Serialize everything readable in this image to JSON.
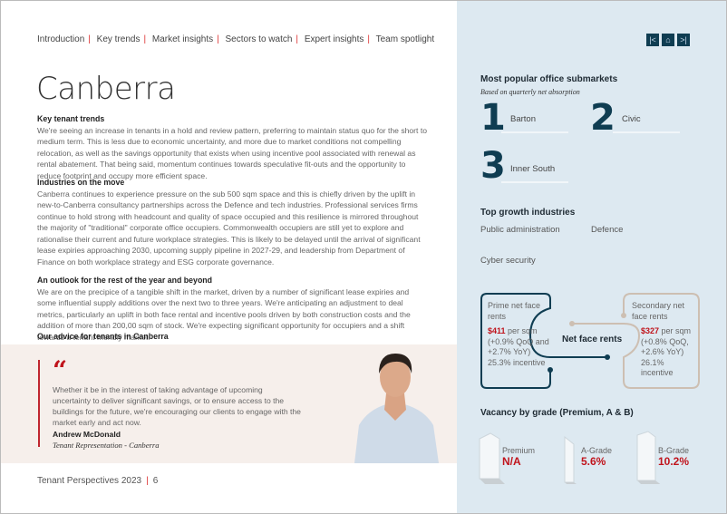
{
  "nav": {
    "items": [
      "Introduction",
      "Key trends",
      "Market insights",
      "Sectors to watch",
      "Expert insights",
      "Team spotlight"
    ]
  },
  "title": "Canberra",
  "sections": [
    {
      "heading": "Key tenant trends",
      "body": "We're seeing an increase in tenants in a hold and review pattern, preferring to maintain status quo for the short to medium term. This is less due to economic uncertainty, and more due to market conditions not compelling relocation, as well as the savings opportunity that exists when using incentive pool associated with renewal as rental abatement. That being said, momentum continues towards speculative fit-outs and the opportunity to reduce footprint and occupy more efficient space."
    },
    {
      "heading": "Industries on the move",
      "body": "Canberra continues to experience pressure on the sub 500 sqm space and this is chiefly driven by the uplift in new-to-Canberra consultancy partnerships across the Defence and tech industries. Professional services firms continue to hold strong with headcount and quality of space occupied and this resilience is mirrored throughout the majority of \"traditional\" corporate office occupiers. Commonwealth occupiers are still yet to explore and rationalise their current and future workplace strategies. This is likely to be delayed until the arrival of significant lease expiries approaching 2030, upcoming supply pipeline in 2027-29, and leadership from Department of Finance on both workplace strategy and ESG corporate governance."
    },
    {
      "heading": "An outlook for the rest of the year and beyond",
      "body": "We are on the precipice of a tangible shift in the market, driven by a number of significant lease expiries and some influential supply additions over the next two to three years. We're anticipating an adjustment to deal metrics, particularly an uplift in both face rental and incentive pools driven by both construction costs and the addition of more than 200,00 sqm of stock. We're expecting significant opportunity for occupiers and a shift towards a tenant friendly market."
    },
    {
      "heading": "Our advice for tenants in Canberra",
      "body": ""
    }
  ],
  "quote": {
    "mark": "“",
    "text": "Whether it be in the interest of taking advantage of upcoming uncertainty to deliver significant savings, or to ensure access to the buildings for the future, we're encouraging our clients to engage with the market early and act now.",
    "name": "Andrew McDonald",
    "role": "Tenant Representation - Canberra"
  },
  "footer": {
    "publication": "Tenant Perspectives 2023",
    "page": "6"
  },
  "page_nav": {
    "icons": [
      "first-page-icon",
      "home-icon",
      "last-page-icon"
    ]
  },
  "submarkets": {
    "heading": "Most popular office submarkets",
    "subheading": "Based on quarterly net absorption",
    "items": [
      {
        "rank": "1",
        "name": "Barton"
      },
      {
        "rank": "2",
        "name": "Civic"
      },
      {
        "rank": "3",
        "name": "Inner South"
      }
    ]
  },
  "industries": {
    "heading": "Top growth industries",
    "items": [
      "Public administration",
      "Defence",
      "Cyber security"
    ]
  },
  "rents": {
    "center": "Net face rents",
    "prime": {
      "label": "Prime net face rents",
      "value": "$411",
      "unit": " per sqm",
      "change": "(+0.9% QoQ and +2.7% YoY)",
      "incentive": "25.3% incentive"
    },
    "secondary": {
      "label": "Secondary net face rents",
      "value": "$327",
      "unit": " per sqm",
      "change": "(+0.8% QoQ, +2.6% YoY)",
      "incentive": "26.1% incentive"
    }
  },
  "vacancy": {
    "heading": "Vacancy by grade (Premium, A & B)",
    "grades": [
      {
        "label": "Premium",
        "value": "N/A"
      },
      {
        "label": "A-Grade",
        "value": "5.6%"
      },
      {
        "label": "B-Grade",
        "value": "10.2%"
      }
    ]
  },
  "colors": {
    "accent": "#c0141c",
    "navy": "#0f3d52",
    "panel": "#dde9f1",
    "secondary_line": "#cdbfb2"
  }
}
